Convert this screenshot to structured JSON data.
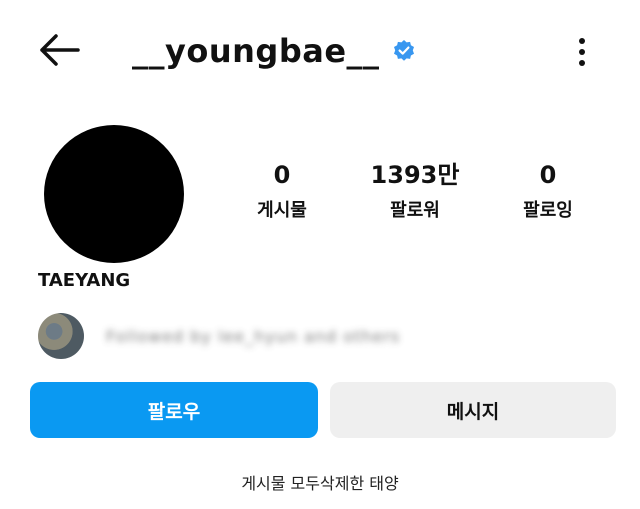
{
  "header": {
    "username": "__youngbae__",
    "verified_badge_color": "#3897f0"
  },
  "profile": {
    "display_name": "TAEYANG",
    "stats": [
      {
        "value": "0",
        "label": "게시물"
      },
      {
        "value": "1393만",
        "label": "팔로워"
      },
      {
        "value": "0",
        "label": "팔로잉"
      }
    ],
    "followed_by_text": "Followed by lee_hyun and others"
  },
  "actions": {
    "follow_label": "팔로우",
    "follow_color": "#0a99f2",
    "message_label": "메시지"
  },
  "caption": "게시물 모두삭제한 태양"
}
